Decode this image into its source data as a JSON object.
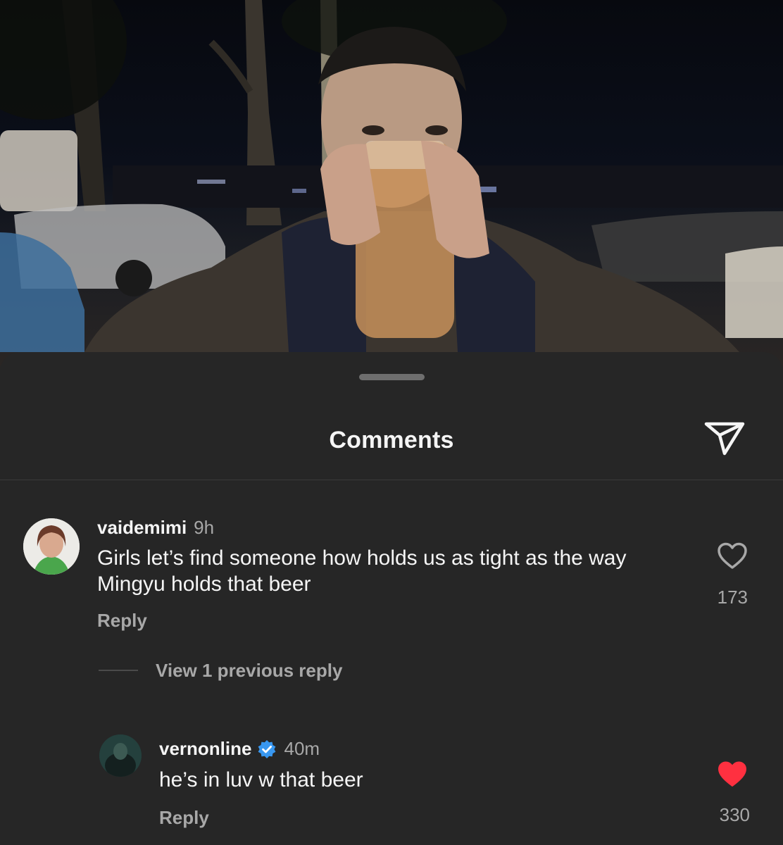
{
  "sheet": {
    "title": "Comments"
  },
  "comments": [
    {
      "username": "vaidemimi",
      "time": "9h",
      "text_line1": "Girls let’s find someone how holds us as tight as the way",
      "text_line2": "Mingyu holds that beer",
      "reply_label": "Reply",
      "likes": "173",
      "liked": false
    }
  ],
  "view_replies_label": "View 1 previous reply",
  "reply": {
    "username": "vernonline",
    "verified": true,
    "time": "40m",
    "text": "he’s in luv w that beer",
    "reply_label": "Reply",
    "likes": "330",
    "liked": true
  },
  "colors": {
    "sheet_bg": "#262626",
    "secondary_text": "#a8a8a8",
    "like_red": "#ff3040",
    "verified_blue": "#3897f0"
  },
  "icons": {
    "share": "paper-plane-icon",
    "like": "heart-outline-icon",
    "liked": "heart-filled-icon",
    "verified": "verified-badge-icon"
  }
}
